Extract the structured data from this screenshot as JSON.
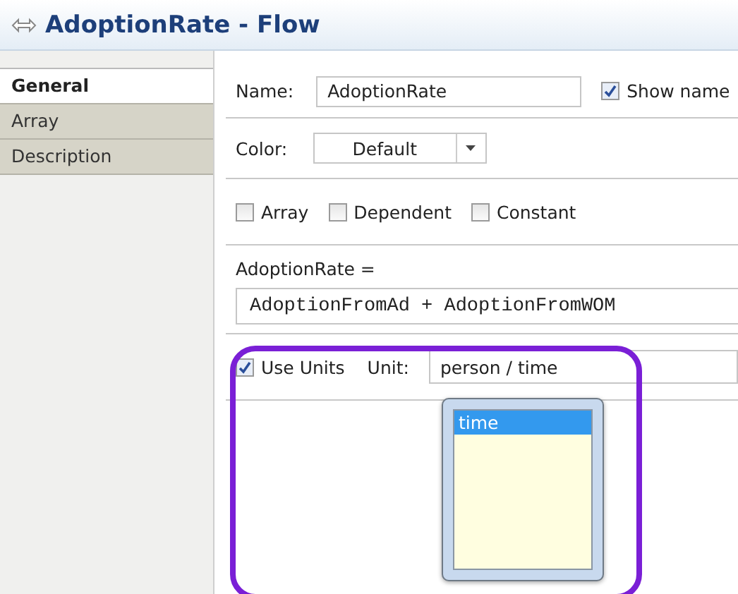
{
  "title": "AdoptionRate - Flow",
  "tabs": [
    {
      "label": "General",
      "selected": true
    },
    {
      "label": "Array",
      "selected": false
    },
    {
      "label": "Description",
      "selected": false
    }
  ],
  "name": {
    "label": "Name:",
    "value": "AdoptionRate"
  },
  "show_name": {
    "label": "Show name",
    "checked": true
  },
  "color": {
    "label": "Color:",
    "value": "Default"
  },
  "flags": [
    {
      "label": "Array",
      "checked": false
    },
    {
      "label": "Dependent",
      "checked": false
    },
    {
      "label": "Constant",
      "checked": false
    }
  ],
  "equation": {
    "label": "AdoptionRate =",
    "value": "AdoptionFromAd + AdoptionFromWOM"
  },
  "use_units": {
    "label": "Use Units",
    "checked": true
  },
  "unit": {
    "label": "Unit:",
    "value": "person / time"
  },
  "suggestions": [
    {
      "label": "time",
      "selected": true
    }
  ]
}
